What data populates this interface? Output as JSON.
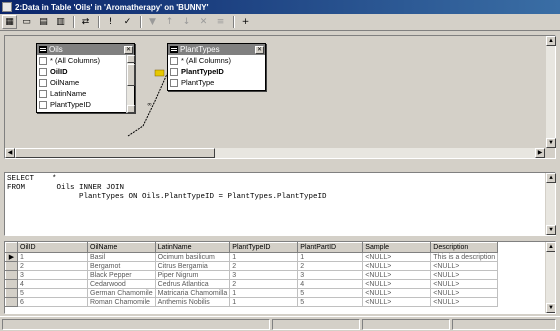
{
  "window": {
    "title": "2:Data in Table 'Oils' in 'Aromatherapy' on 'BUNNY'"
  },
  "toolbar": {
    "buttons": [
      {
        "name": "grid-pane-icon",
        "glyph": "▦"
      },
      {
        "name": "sql-pane-icon",
        "glyph": "▭"
      },
      {
        "name": "diagram-pane-icon",
        "glyph": "▤"
      },
      {
        "name": "results-pane-icon",
        "glyph": "▥"
      },
      {
        "name": "change-type-icon",
        "glyph": "⇄"
      },
      {
        "name": "run-icon",
        "glyph": "!"
      },
      {
        "name": "verify-sql-icon",
        "glyph": "✓"
      },
      {
        "name": "filter-icon",
        "glyph": "▼"
      },
      {
        "name": "sort-asc-icon",
        "glyph": "↑"
      },
      {
        "name": "sort-desc-icon",
        "glyph": "↓"
      },
      {
        "name": "remove-filter-icon",
        "glyph": "✕"
      },
      {
        "name": "group-by-icon",
        "glyph": "≡"
      },
      {
        "name": "add-table-icon",
        "glyph": "+"
      }
    ]
  },
  "diagram": {
    "tables": [
      {
        "name": "Oils",
        "columns": [
          {
            "label": "* (All Columns)",
            "bold": false
          },
          {
            "label": "OilID",
            "bold": true
          },
          {
            "label": "OilName",
            "bold": false
          },
          {
            "label": "LatinName",
            "bold": false
          },
          {
            "label": "PlantTypeID",
            "bold": false
          }
        ]
      },
      {
        "name": "PlantTypes",
        "columns": [
          {
            "label": "* (All Columns)",
            "bold": false
          },
          {
            "label": "PlantTypeID",
            "bold": true
          },
          {
            "label": "PlantType",
            "bold": false
          }
        ]
      }
    ]
  },
  "sql": {
    "lines": [
      "SELECT    *",
      "FROM       Oils INNER JOIN",
      "                PlantTypes ON Oils.PlantTypeID = PlantTypes.PlantTypeID"
    ]
  },
  "grid": {
    "headers": [
      "OilID",
      "OilName",
      "LatinName",
      "PlantTypeID",
      "PlantPartID",
      "Sample",
      "Description"
    ],
    "rows": [
      [
        "1",
        "Basil",
        "Ocimum basilicum",
        "1",
        "1",
        "<NULL>",
        "This is a description"
      ],
      [
        "2",
        "Bergamot",
        "Citrus Bergamia",
        "2",
        "2",
        "<NULL>",
        "<NULL>"
      ],
      [
        "3",
        "Black Pepper",
        "Piper Nigrum",
        "3",
        "3",
        "<NULL>",
        "<NULL>"
      ],
      [
        "4",
        "Cedarwood",
        "Cedrus Atlantica",
        "2",
        "4",
        "<NULL>",
        "<NULL>"
      ],
      [
        "5",
        "German Chamomile",
        "Matricaria Chamomilla",
        "1",
        "5",
        "<NULL>",
        "<NULL>"
      ],
      [
        "6",
        "Roman Chamomile",
        "Anthemis Nobilis",
        "1",
        "5",
        "<NULL>",
        "<NULL>"
      ]
    ],
    "current_row_marker": "▶"
  },
  "colors": {
    "title_start": "#0a246a",
    "title_end": "#3a6ea5",
    "chrome": "#d4d0c8",
    "link_key": "#e6c800"
  }
}
